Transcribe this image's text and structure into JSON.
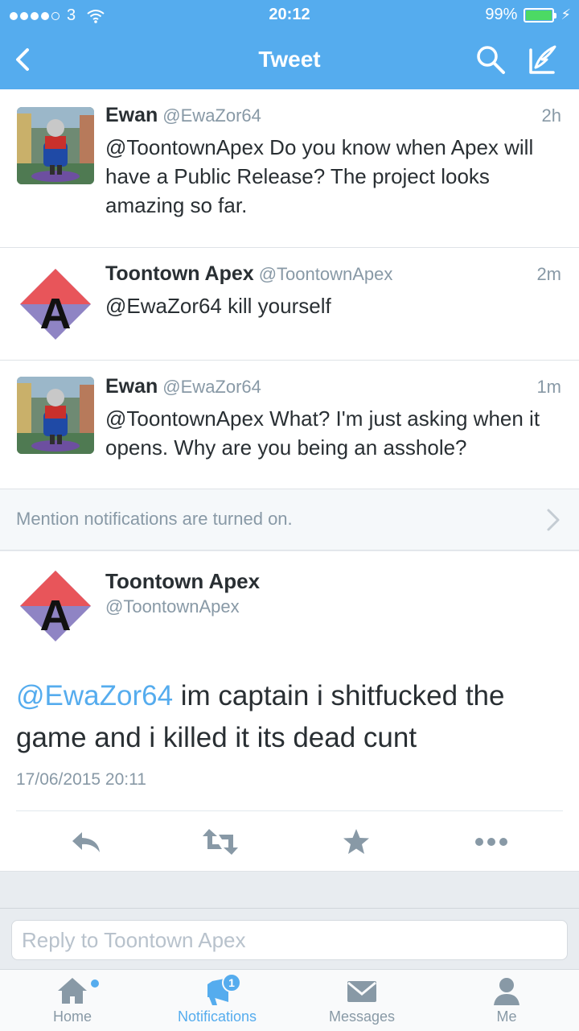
{
  "status_bar": {
    "carrier": "3",
    "time": "20:12",
    "battery_percent": "99%",
    "battery_level": 0.99
  },
  "nav": {
    "title": "Tweet",
    "icons": [
      "back-icon",
      "search-icon",
      "compose-icon"
    ]
  },
  "conversation": [
    {
      "name": "Ewan",
      "handle": "@EwaZor64",
      "age": "2h",
      "text": "@ToontownApex Do you know when Apex will have a Public Release? The project looks amazing so far."
    },
    {
      "name": "Toontown Apex",
      "handle": "@ToontownApex",
      "age": "2m",
      "text": "@EwaZor64 kill yourself"
    },
    {
      "name": "Ewan",
      "handle": "@EwaZor64",
      "age": "1m",
      "text": "@ToontownApex What? I'm just asking when it opens. Why are you being an asshole?"
    }
  ],
  "mention_notice": "Mention notifications are turned on.",
  "main_tweet": {
    "name": "Toontown Apex",
    "handle": "@ToontownApex",
    "mention": "@EwaZor64",
    "text": " im captain i shitfucked the game and i killed it its dead cunt",
    "timestamp": "17/06/2015 20:11",
    "actions": [
      "reply-icon",
      "retweet-icon",
      "favorite-icon",
      "more-icon"
    ]
  },
  "reply": {
    "placeholder": "Reply to Toontown Apex",
    "value": ""
  },
  "tabs": [
    {
      "label": "Home",
      "icon": "home-icon"
    },
    {
      "label": "Notifications",
      "icon": "notifications-icon",
      "badge": "1",
      "active": true
    },
    {
      "label": "Messages",
      "icon": "messages-icon"
    },
    {
      "label": "Me",
      "icon": "me-icon"
    }
  ],
  "colors": {
    "accent": "#55acee",
    "text": "#292f33",
    "muted": "#8899a6",
    "battery": "#4cd964"
  }
}
